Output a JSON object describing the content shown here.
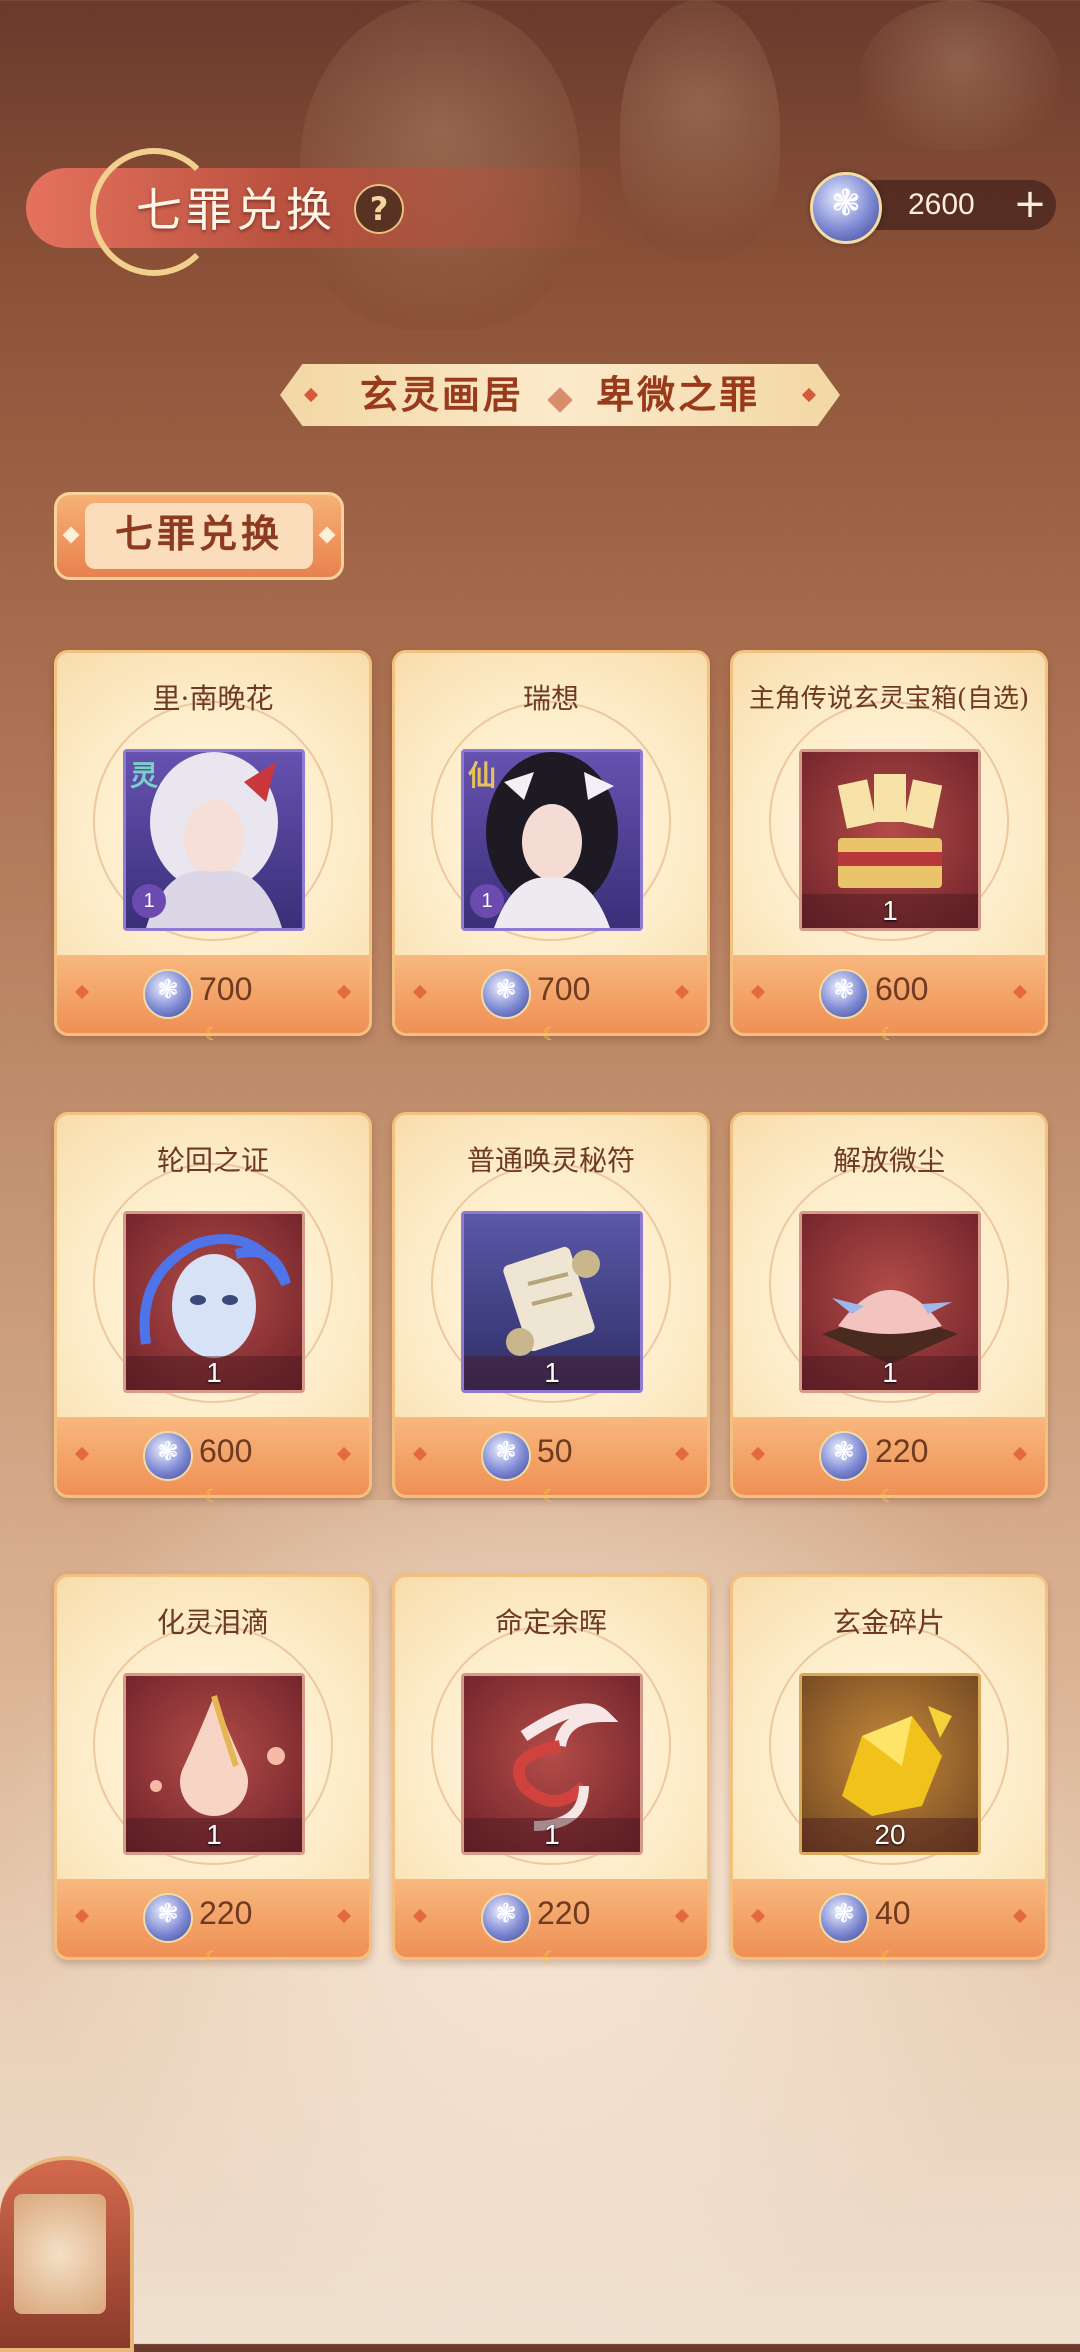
{
  "header": {
    "title": "七罪兑换",
    "help_icon": "?",
    "currency_amount": "2600",
    "add_icon": "+"
  },
  "sub_banner": {
    "left": "玄灵画居",
    "right": "卑微之罪"
  },
  "section_tab": "七罪兑换",
  "items": [
    {
      "name": "里·南晚花",
      "qty": "1",
      "price": "700",
      "type": "character",
      "tag": "灵",
      "icon": "character-portrait-icon"
    },
    {
      "name": "瑞想",
      "qty": "1",
      "price": "700",
      "type": "character",
      "tag": "仙",
      "icon": "character-portrait-icon"
    },
    {
      "name": "主角传说玄灵宝箱(自选)",
      "qty": "1",
      "price": "600",
      "type": "item",
      "icon": "treasure-chest-icon"
    },
    {
      "name": "轮回之证",
      "qty": "1",
      "price": "600",
      "type": "item",
      "icon": "mask-icon"
    },
    {
      "name": "普通唤灵秘符",
      "qty": "1",
      "price": "50",
      "type": "item",
      "icon": "scroll-icon"
    },
    {
      "name": "解放微尘",
      "qty": "1",
      "price": "220",
      "type": "item",
      "icon": "dust-pile-icon"
    },
    {
      "name": "化灵泪滴",
      "qty": "1",
      "price": "220",
      "type": "item",
      "icon": "teardrop-icon"
    },
    {
      "name": "命定余晖",
      "qty": "1",
      "price": "220",
      "type": "item",
      "icon": "swirl-icon"
    },
    {
      "name": "玄金碎片",
      "qty": "20",
      "price": "40",
      "type": "item",
      "icon": "gold-shard-icon"
    }
  ],
  "colors": {
    "accent": "#e8814e",
    "card_bg": "#fdecc8",
    "title_text": "#9a3a1c"
  }
}
